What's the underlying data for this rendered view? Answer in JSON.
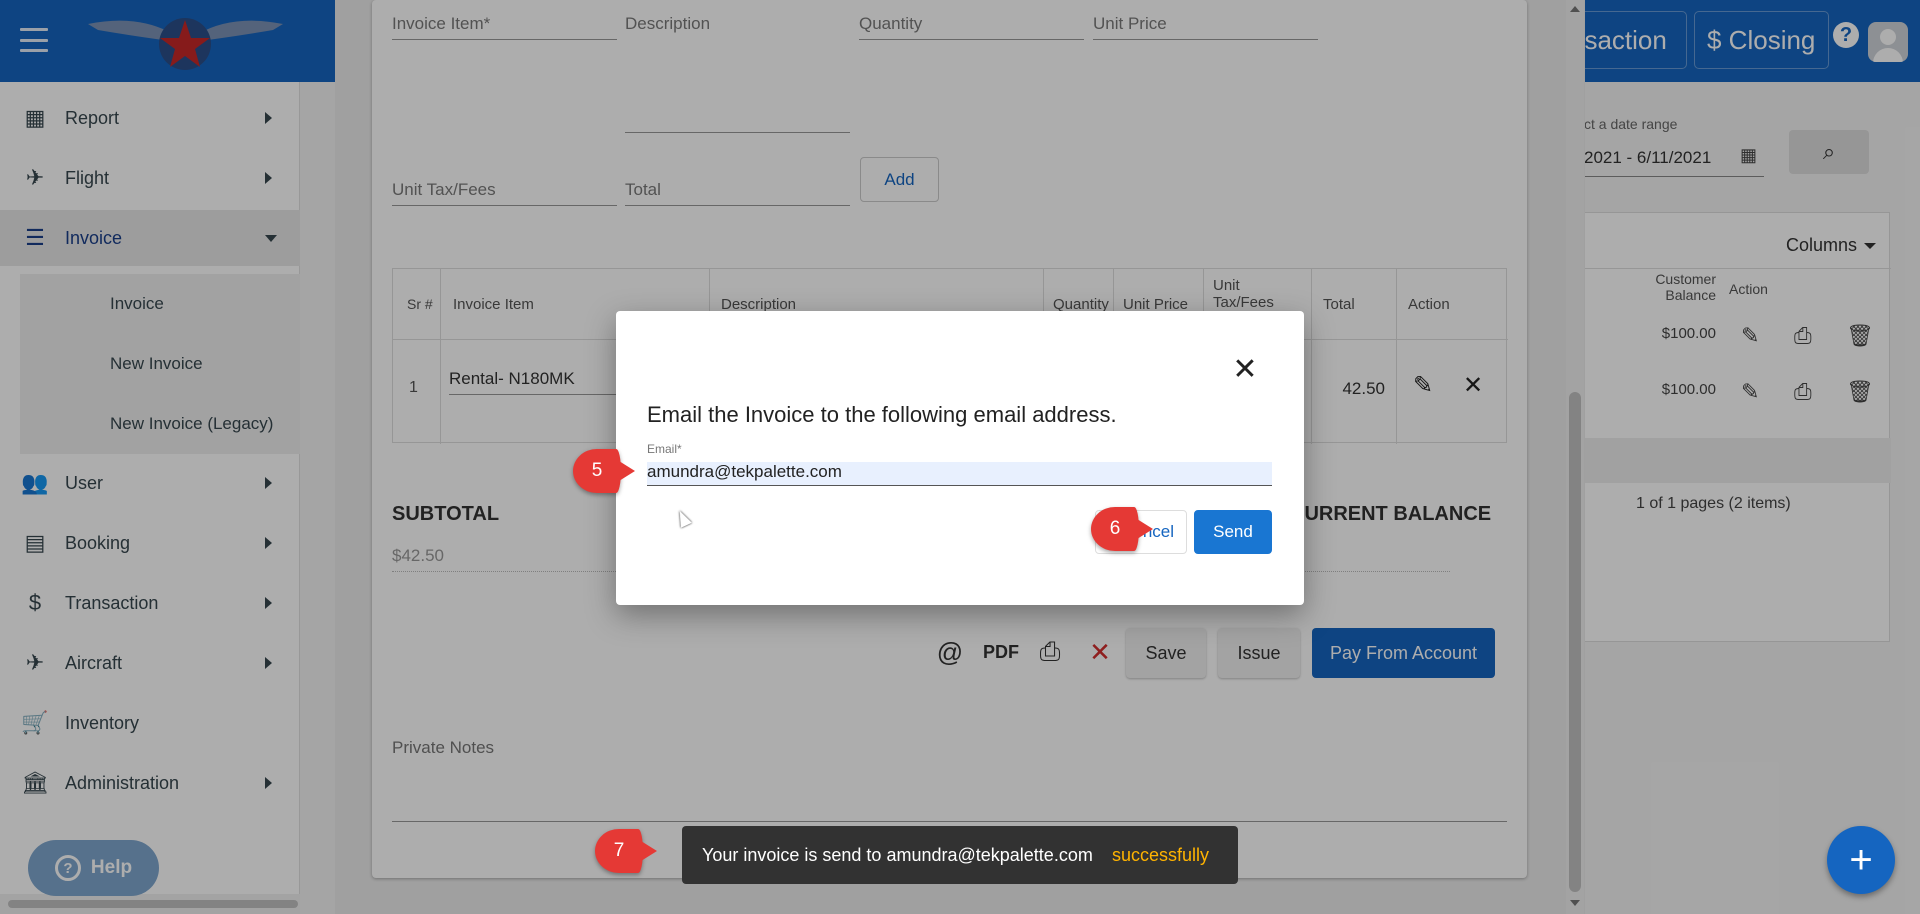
{
  "appbar": {
    "transaction_label": "nsaction",
    "closing_label": "$ Closing",
    "help_glyph": "?"
  },
  "sidebar": {
    "items": [
      {
        "label": "Report",
        "icon": "table-icon"
      },
      {
        "label": "Flight",
        "icon": "airplane-takeoff-icon"
      },
      {
        "label": "Invoice",
        "icon": "receipt-icon"
      },
      {
        "label": "User",
        "icon": "people-icon"
      },
      {
        "label": "Booking",
        "icon": "calendar-icon"
      },
      {
        "label": "Transaction",
        "icon": "dollar-icon"
      },
      {
        "label": "Aircraft",
        "icon": "airplane-landing-icon"
      },
      {
        "label": "Inventory",
        "icon": "cart-icon"
      },
      {
        "label": "Administration",
        "icon": "bank-icon"
      }
    ],
    "sub_items": [
      "Invoice",
      "New Invoice",
      "New Invoice (Legacy)"
    ],
    "help_label": "Help"
  },
  "background": {
    "date_range_label": "ct a date range",
    "date_range_value": "2021 - 6/11/2021",
    "columns_label": "Columns",
    "col_customer_balance": "Customer Balance",
    "col_action": "Action",
    "balance_1": "$100.00",
    "balance_2": "$100.00",
    "pagination": "1 of 1 pages (2 items)"
  },
  "invoice_form": {
    "invoice_item_label": "Invoice Item*",
    "description_label": "Description",
    "quantity_label": "Quantity",
    "unit_price_label": "Unit Price",
    "unit_tax_label": "Unit Tax/Fees",
    "total_label": "Total",
    "add_button": "Add",
    "table_headers": {
      "sr": "Sr #",
      "invoice_item": "Invoice Item",
      "description": "Description",
      "quantity": "Quantity",
      "unit_price": "Unit Price",
      "unit_tax": "Unit Tax/Fees",
      "total": "Total",
      "action": "Action"
    },
    "row": {
      "sr": "1",
      "invoice_item": "Rental- N180MK",
      "total": "42.50"
    },
    "subtotal_label": "SUBTOTAL",
    "subtotal_value": "$42.50",
    "current_balance_label": "CURRENT BALANCE",
    "save_button": "Save",
    "issue_button": "Issue",
    "pay_button": "Pay From Account",
    "private_notes_label": "Private Notes"
  },
  "dialog": {
    "title": "Email the Invoice to the following email address.",
    "email_label": "Email*",
    "email_value": "amundra@tekpalette.com",
    "cancel_button": "ncel",
    "send_button": "Send"
  },
  "markers": {
    "m5": "5",
    "m6": "6",
    "m7": "7"
  },
  "snackbar": {
    "message": "Your invoice is send to amundra@tekpalette.com",
    "status": "successfully"
  },
  "fab_label": "+",
  "colors": {
    "primary": "#1565c0",
    "accent_orange": "#ffb300",
    "marker_red": "#e53935"
  }
}
